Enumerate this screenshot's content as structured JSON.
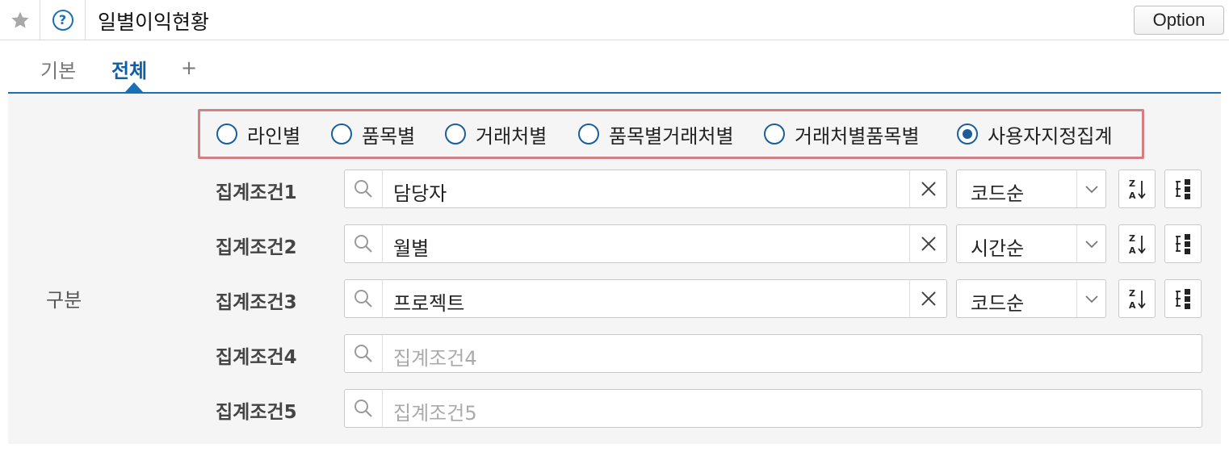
{
  "header": {
    "title": "일별이익현황",
    "option_label": "Option",
    "favorite_icon": "star-icon",
    "help_icon": "help-icon",
    "help_glyph": "?"
  },
  "tabs": [
    {
      "label": "기본",
      "active": false
    },
    {
      "label": "전체",
      "active": true
    },
    {
      "label": "+",
      "active": false
    }
  ],
  "panel": {
    "row_label": "구분",
    "radio_options": [
      {
        "label": "라인별",
        "checked": false
      },
      {
        "label": "품목별",
        "checked": false
      },
      {
        "label": "거래처별",
        "checked": false
      },
      {
        "label": "품목별거래처별",
        "checked": false
      },
      {
        "label": "거래처별품목별",
        "checked": false
      },
      {
        "label": "사용자지정집계",
        "checked": true
      }
    ],
    "conditions": [
      {
        "label": "집계조건1",
        "value": "담당자",
        "placeholder": "",
        "sort": "코드순"
      },
      {
        "label": "집계조건2",
        "value": "월별",
        "placeholder": "",
        "sort": "시간순"
      },
      {
        "label": "집계조건3",
        "value": "프로젝트",
        "placeholder": "",
        "sort": "코드순"
      },
      {
        "label": "집계조건4",
        "value": "",
        "placeholder": "집계조건4"
      },
      {
        "label": "집계조건5",
        "value": "",
        "placeholder": "집계조건5"
      }
    ]
  },
  "colors": {
    "accent": "#1a6fb5",
    "highlight_border": "#d47f86",
    "panel_bg": "#f5f5f5"
  }
}
